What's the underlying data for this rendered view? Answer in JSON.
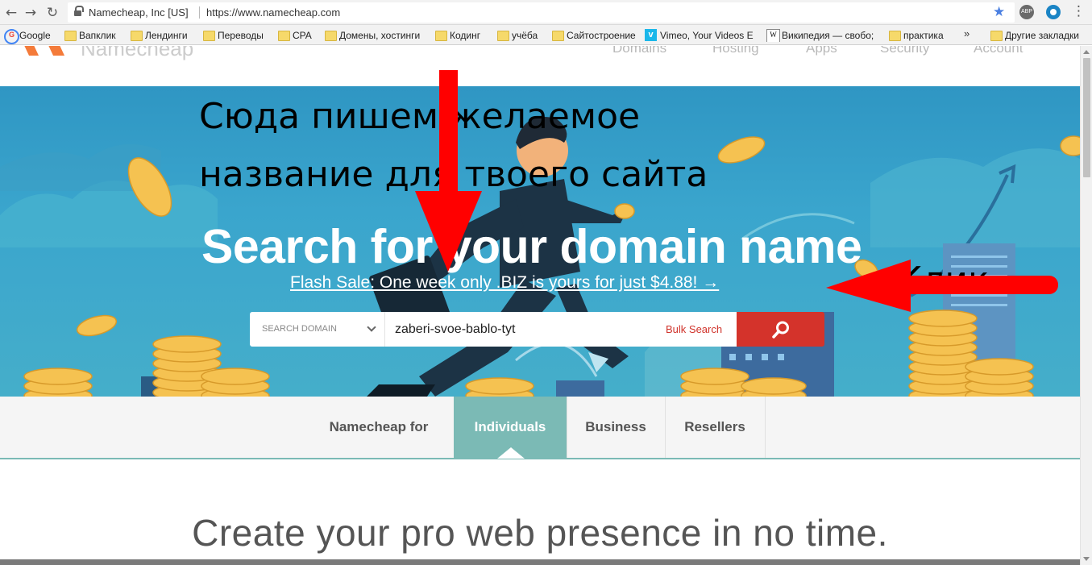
{
  "browser": {
    "site_identity": "Namecheap, Inc [US]",
    "url": "https://www.namecheap.com",
    "extension_abp": "ABP",
    "bookmarks": [
      {
        "label": "Google",
        "kind": "google"
      },
      {
        "label": "Вапклик",
        "kind": "folder"
      },
      {
        "label": "Лендинги",
        "kind": "folder"
      },
      {
        "label": "Переводы",
        "kind": "folder"
      },
      {
        "label": "CPA",
        "kind": "folder"
      },
      {
        "label": "Домены, хостинги",
        "kind": "folder"
      },
      {
        "label": "Кодинг",
        "kind": "folder"
      },
      {
        "label": "учёба",
        "kind": "folder"
      },
      {
        "label": "Сайтостроение",
        "kind": "folder"
      },
      {
        "label": "Vimeo, Your Videos E",
        "kind": "vimeo"
      },
      {
        "label": "Википедия — свобо;",
        "kind": "wiki"
      },
      {
        "label": "практика",
        "kind": "folder"
      }
    ],
    "more_label": "»",
    "other_bookmarks": "Другие закладки"
  },
  "site": {
    "logo_text": "Namecheap",
    "nav": [
      "Domains",
      "Hosting",
      "Apps",
      "Security",
      "Account"
    ]
  },
  "hero": {
    "headline": "Search for your domain name",
    "promo": "Flash Sale: One week only .BIZ is yours for just $4.88! →",
    "search": {
      "select_label": "SEARCH DOMAIN",
      "value": "zaberi-svoe-bablo-tyt",
      "bulk_label": "Bulk Search"
    }
  },
  "annotations": {
    "line1": "Сюда пишем желаемое",
    "line2": "название для твоего сайта",
    "click": "Клик"
  },
  "tabs": {
    "prefix": "Namecheap for",
    "items": [
      "Individuals",
      "Business",
      "Resellers"
    ],
    "active": "Individuals"
  },
  "section": {
    "heading": "Create your pro web presence in no time."
  },
  "colors": {
    "accent_red": "#d4332b",
    "tab_active": "#7bbab5",
    "hero_blue": "#3aa5cd"
  }
}
